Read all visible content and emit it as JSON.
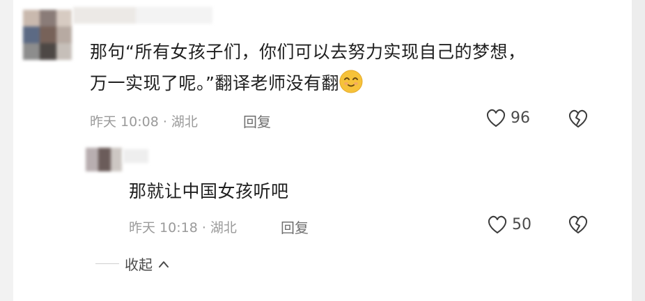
{
  "comment": {
    "text_line1": "那句“所有女孩子们，你们可以去努力实现自己的梦想，",
    "text_line2": "万一实现了呢。”翻译老师没有翻",
    "meta": "昨天 10:08 · 湖北",
    "reply_label": "回复",
    "like_count": "96",
    "emoji_icon": "smiling-face-emoji"
  },
  "reply": {
    "text": "那就让中国女孩听吧",
    "meta": "昨天 10:18 · 湖北",
    "reply_label": "回复",
    "like_count": "50"
  },
  "collapse_label": "收起",
  "colors": {
    "text": "#1f1f1f",
    "meta": "#9a9a9a",
    "emoji": "#f6c23a"
  }
}
